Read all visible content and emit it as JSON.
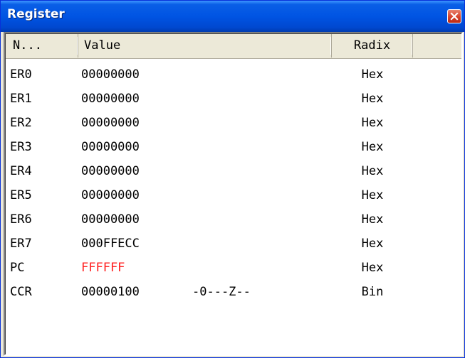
{
  "window": {
    "title": "Register"
  },
  "columns": {
    "name": "N...",
    "value": "Value",
    "radix": "Radix"
  },
  "registers": [
    {
      "name": "ER0",
      "value": "00000000",
      "flags": "",
      "radix": "Hex",
      "changed": false
    },
    {
      "name": "ER1",
      "value": "00000000",
      "flags": "",
      "radix": "Hex",
      "changed": false
    },
    {
      "name": "ER2",
      "value": "00000000",
      "flags": "",
      "radix": "Hex",
      "changed": false
    },
    {
      "name": "ER3",
      "value": "00000000",
      "flags": "",
      "radix": "Hex",
      "changed": false
    },
    {
      "name": "ER4",
      "value": "00000000",
      "flags": "",
      "radix": "Hex",
      "changed": false
    },
    {
      "name": "ER5",
      "value": "00000000",
      "flags": "",
      "radix": "Hex",
      "changed": false
    },
    {
      "name": "ER6",
      "value": "00000000",
      "flags": "",
      "radix": "Hex",
      "changed": false
    },
    {
      "name": "ER7",
      "value": "000FFECC",
      "flags": "",
      "radix": "Hex",
      "changed": false
    },
    {
      "name": "PC",
      "value": "FFFFFF",
      "flags": "",
      "radix": "Hex",
      "changed": true
    },
    {
      "name": "CCR",
      "value": "00000100",
      "flags": "-0---Z--",
      "radix": "Bin",
      "changed": false
    }
  ],
  "colors": {
    "changed_value": "#ff2020",
    "titlebar": "#0054e3"
  },
  "icons": {
    "close": "close-icon"
  }
}
